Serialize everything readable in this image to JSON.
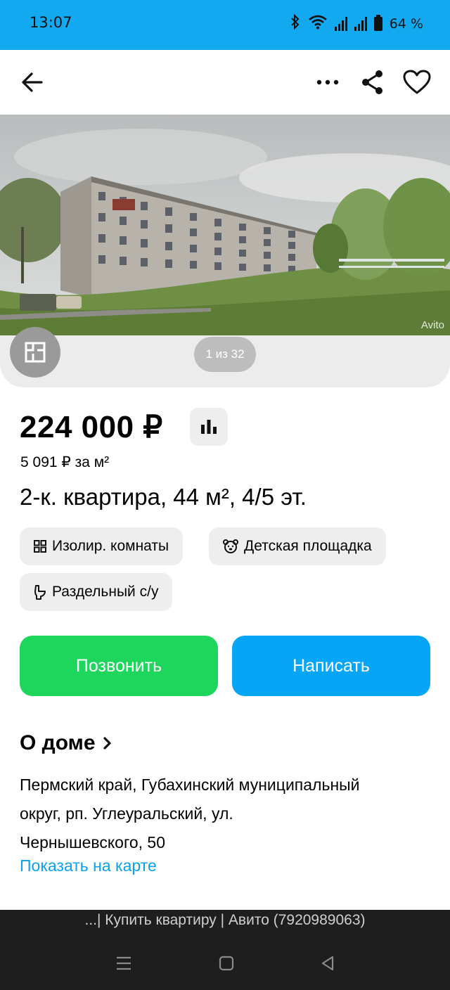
{
  "status_bar": {
    "time": "13:07",
    "battery": "64 %"
  },
  "app_bar": {
    "back_icon": "arrow-left",
    "more_icon": "ellipsis-horizontal",
    "share_icon": "share",
    "favorite_icon": "heart-outline"
  },
  "gallery": {
    "watermark": "Avito",
    "counter": "1 из 32",
    "plan_icon": "floor-plan"
  },
  "listing": {
    "price": "224 000 ₽",
    "price_per_m2": "5 091 ₽ за м²",
    "title": "2-к. квартира, 44 м², 4/5 эт."
  },
  "features": [
    {
      "label": "Изолир. комнаты",
      "icon": "grid-four"
    },
    {
      "label": "Детская площадка",
      "icon": "bear-face"
    },
    {
      "label": "Раздельный с/у",
      "icon": "toilet"
    }
  ],
  "actions": {
    "call": "Позвонить",
    "write": "Написать",
    "colors": {
      "call": "#1fd65d",
      "write": "#07a5f5"
    }
  },
  "house": {
    "section_title": "О доме",
    "address_line1": "Пермский край, Губахинский муниципальный",
    "address_line2": "округ, рп. Углеуральский, ул.",
    "address_line3": "Чернышевского, 50",
    "map_link": "Показать на карте"
  },
  "system": {
    "page_title": "...| Купить квартиру | Авито (7920989063)"
  }
}
